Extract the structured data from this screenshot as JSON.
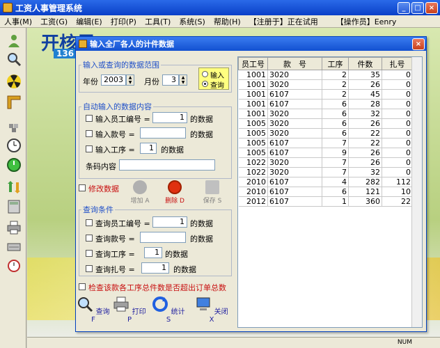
{
  "window": {
    "title": "工资人事管理系统"
  },
  "menubar": {
    "items": [
      "人事(M)",
      "工资(G)",
      "编辑(E)",
      "打印(P)",
      "工具(T)",
      "系统(S)",
      "帮助(H)",
      "【注册于】正在试用",
      "【操作员】Eenry"
    ]
  },
  "background": {
    "logo": "开核思",
    "logo_num": "136"
  },
  "status": {
    "num": "NUM"
  },
  "dialog": {
    "title": "输入全厂各人的计件数据",
    "range_group": {
      "title": "输入或查询的数据范围",
      "year_label": "年份",
      "year": "2003",
      "month_label": "月份",
      "month": "3"
    },
    "mode": {
      "input_label": "输入",
      "query_label": "查询"
    },
    "auto_group": {
      "title": "自动输入的数据内容",
      "emp_label": "输入员工编号 =",
      "emp_value": "1",
      "emp_suffix": "的数据",
      "style_label": "输入款号 =",
      "style_value": "",
      "style_suffix": "的数据",
      "proc_label": "输入工序 =",
      "proc_value": "1",
      "proc_suffix": "的数据",
      "barcode_label": "条码内容",
      "barcode_value": ""
    },
    "modify_label": "修改数据",
    "actions": {
      "add": "增加 A",
      "delete": "删除 D",
      "save": "保存 S"
    },
    "query_group": {
      "title": "查询条件",
      "emp_label": "查询员工编号 =",
      "emp_value": "1",
      "emp_suffix": "的数据",
      "style_label": "查询款号 =",
      "style_value": "",
      "style_suffix": "的数据",
      "proc_label": "查询工序 =",
      "proc_value": "1",
      "proc_suffix": "的数据",
      "bundle_label": "查询扎号 =",
      "bundle_value": "1",
      "bundle_suffix": "的数据"
    },
    "check_label": "检查该款各工序总件数是否超出订单总数",
    "bottom": {
      "query": "查询 F",
      "print": "打印 P",
      "stats": "统计 S",
      "close": "关闭 X"
    },
    "table": {
      "headers": [
        "员工号",
        "款　号",
        "工序",
        "件数",
        "扎号"
      ],
      "rows": [
        [
          "1001",
          "3020",
          "2",
          "35",
          "0"
        ],
        [
          "1001",
          "3020",
          "2",
          "26",
          "0"
        ],
        [
          "1001",
          "6107",
          "2",
          "45",
          "0"
        ],
        [
          "1001",
          "6107",
          "6",
          "28",
          "0"
        ],
        [
          "1001",
          "3020",
          "6",
          "32",
          "0"
        ],
        [
          "1005",
          "3020",
          "6",
          "26",
          "0"
        ],
        [
          "1005",
          "3020",
          "6",
          "22",
          "0"
        ],
        [
          "1005",
          "6107",
          "7",
          "22",
          "0"
        ],
        [
          "1005",
          "6107",
          "9",
          "26",
          "0"
        ],
        [
          "1022",
          "3020",
          "7",
          "26",
          "0"
        ],
        [
          "1022",
          "3020",
          "7",
          "32",
          "0"
        ],
        [
          "2010",
          "6107",
          "4",
          "282",
          "112"
        ],
        [
          "2010",
          "6107",
          "6",
          "121",
          "10"
        ],
        [
          "2012",
          "6107",
          "1",
          "360",
          "22"
        ]
      ]
    }
  },
  "colors": {
    "title_blue": "#0a3fc8",
    "group_title": "#2050c8",
    "accent_red": "#c81010"
  }
}
